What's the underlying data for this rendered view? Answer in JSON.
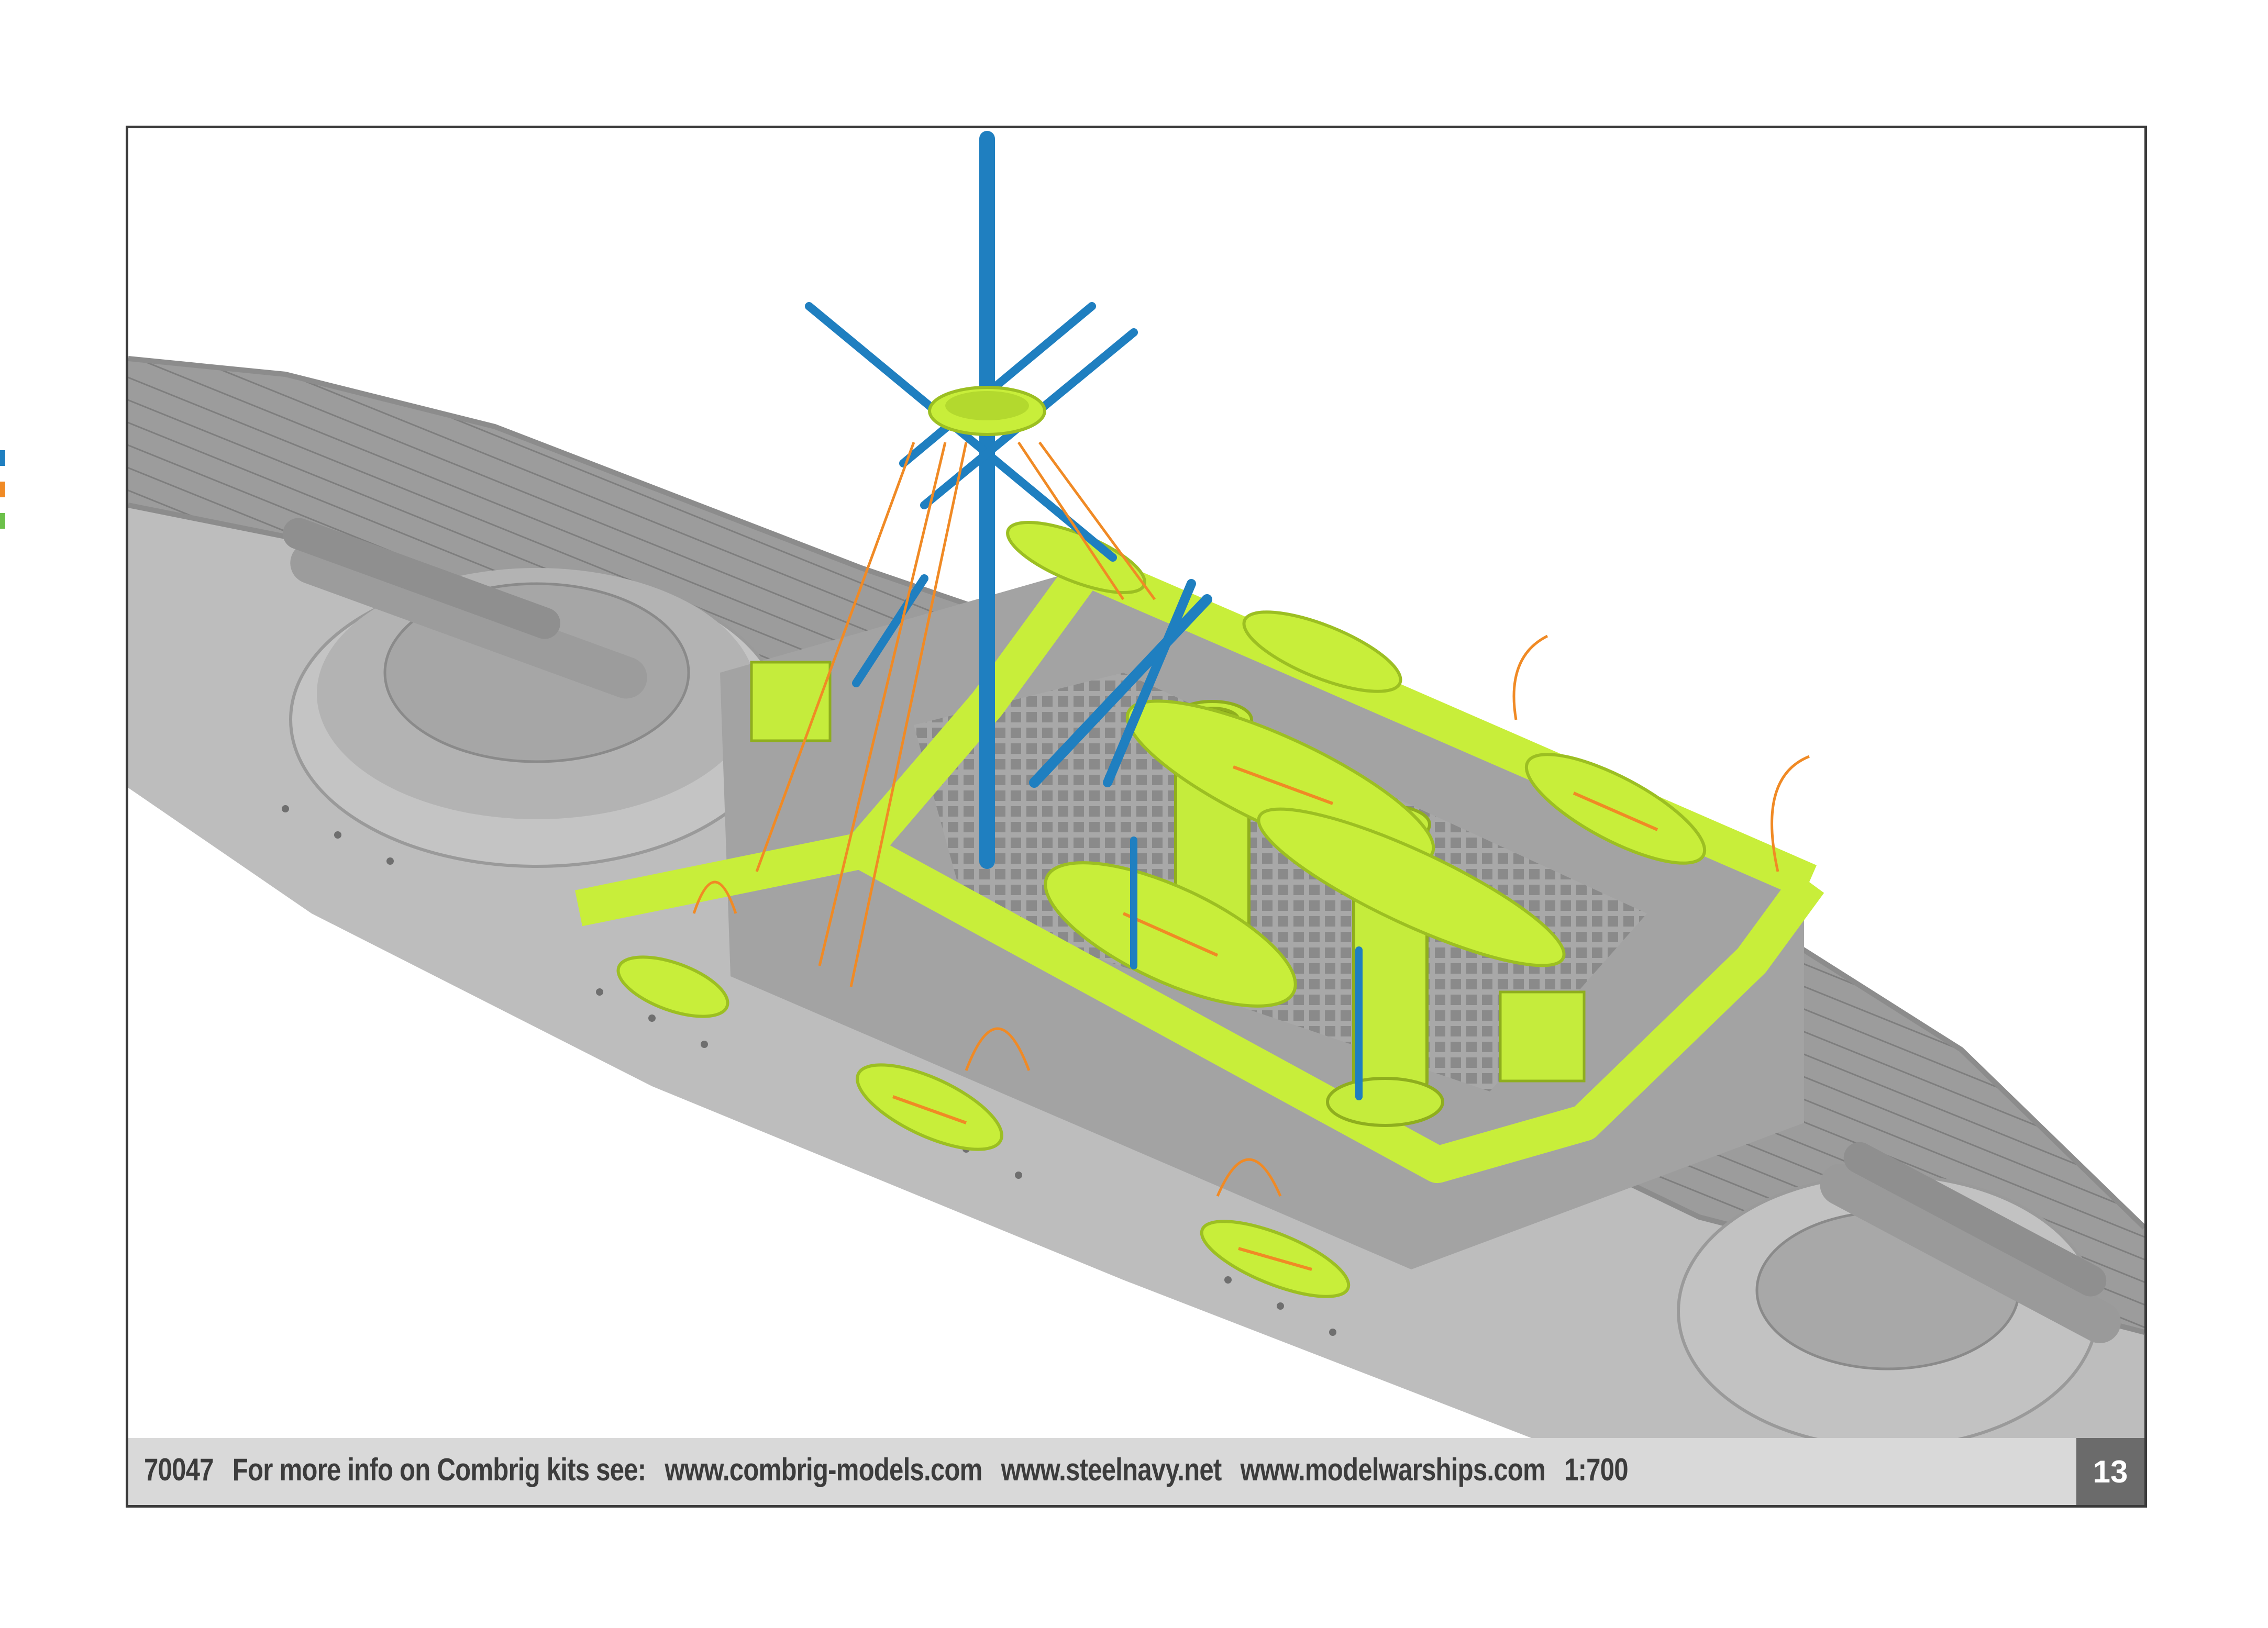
{
  "colors": {
    "hull": "#b9b9b9",
    "deck": "#9a9a9a",
    "photo_etch": "#c8ee3a",
    "mast_blue": "#1f7fc0",
    "rigging_orange": "#f08a25",
    "legend_blue": "#1f7fc0",
    "legend_orange": "#f08a25",
    "legend_green": "#6cc04a"
  },
  "illustration": {
    "icon": "battleship-model-3d-icon"
  },
  "footer": {
    "kit_number": "70047",
    "info_label": "For more info on Combrig kits see:",
    "url_1": "www.combrig-models.com",
    "url_2": "www.steelnavy.net",
    "url_3": "www.modelwarships.com",
    "scale": "1:700",
    "page_number": "13"
  }
}
